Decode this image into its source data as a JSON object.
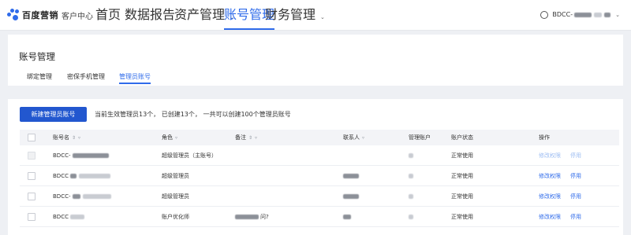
{
  "brand": {
    "name": "百度营销",
    "subtitle": "客户中心"
  },
  "nav": [
    {
      "label": "首页",
      "has_menu": false,
      "active": false
    },
    {
      "label": "数据报告",
      "has_menu": true,
      "active": false
    },
    {
      "label": "资产管理",
      "has_menu": true,
      "active": false
    },
    {
      "label": "账号管理",
      "has_menu": false,
      "active": true
    },
    {
      "label": "财务管理",
      "has_menu": true,
      "active": false
    }
  ],
  "user": {
    "name_prefix": "BDCC-",
    "icon": "user-circle-icon"
  },
  "page": {
    "title": "账号管理",
    "subtabs": [
      "绑定管理",
      "密保手机管理",
      "管理员账号"
    ],
    "active_subtab": "管理员账号"
  },
  "toolbar": {
    "create_button": "新建管理员账号",
    "summary": "当前生效管理员13个， 已创建13个， 一共可以创建100个管理员账号"
  },
  "table": {
    "columns": [
      "账号名",
      "角色",
      "备注",
      "联系人",
      "管理账户",
      "账户状态",
      "操作"
    ],
    "rows": [
      {
        "account": "BDCC-",
        "role": "超级管理员（主账号）",
        "remark": "",
        "status": "正常使用",
        "ops": [
          "修改权限",
          "停用"
        ],
        "ops_disabled": true
      },
      {
        "account": "BDCC",
        "role": "超级管理员",
        "remark": "",
        "status": "正常使用",
        "ops": [
          "修改权限",
          "停用"
        ],
        "ops_disabled": false
      },
      {
        "account": "BDCC-",
        "role": "超级管理员",
        "remark": "",
        "status": "正常使用",
        "ops": [
          "修改权限",
          "停用"
        ],
        "ops_disabled": false
      },
      {
        "account": "BDCC",
        "role": "账户优化师",
        "remark": "问?",
        "status": "正常使用",
        "ops": [
          "修改权限",
          "停用"
        ],
        "ops_disabled": false
      }
    ]
  },
  "colors": {
    "accent": "#2f6bea",
    "primary_button": "#2257cf",
    "page_bg": "#eef0f4"
  }
}
